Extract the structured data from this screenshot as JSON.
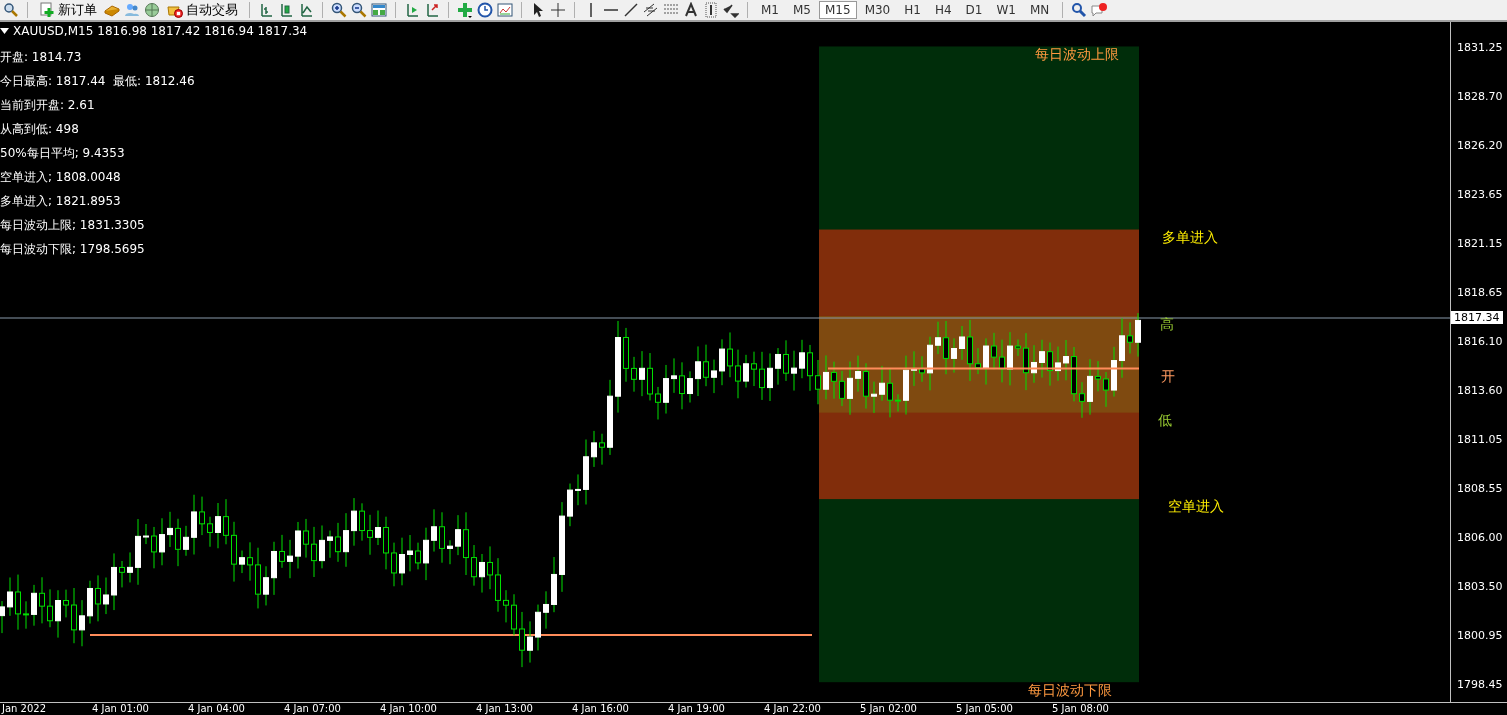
{
  "toolbar": {
    "buttons": [
      {
        "label": "新订单"
      },
      {
        "label": "自动交易"
      }
    ],
    "timeframes": [
      {
        "label": "M1",
        "selected": false
      },
      {
        "label": "M5",
        "selected": false
      },
      {
        "label": "M15",
        "selected": true
      },
      {
        "label": "M30",
        "selected": false
      },
      {
        "label": "H1",
        "selected": false
      },
      {
        "label": "H4",
        "selected": false
      },
      {
        "label": "D1",
        "selected": false
      },
      {
        "label": "W1",
        "selected": false
      },
      {
        "label": "MN",
        "selected": false
      }
    ]
  },
  "chart": {
    "symbol": "XAUUSD,M15",
    "ohlc": "1816.98 1817.42 1816.94 1817.34",
    "info_lines": [
      "开盘: 1814.73",
      "今日最高: 1817.44  最低: 1812.46",
      "当前到开盘: 2.61",
      "从高到低: 498",
      "50%每日平均; 9.4353",
      "空单进入; 1808.0048",
      "多单进入; 1821.8953",
      "每日波动上限; 1831.3305",
      "每日波动下限; 1798.5695"
    ],
    "zone_labels": {
      "upper_limit": "每日波动上限",
      "long_entry": "多单进入",
      "high": "高",
      "open": "开",
      "low": "低",
      "short_entry": "空单进入",
      "lower_limit": "每日波动下限"
    },
    "price_axis": [
      "1831.25",
      "1828.70",
      "1826.20",
      "1823.65",
      "1821.15",
      "1818.65",
      "1816.10",
      "1813.60",
      "1811.05",
      "1808.55",
      "1806.00",
      "1803.50",
      "1800.95",
      "1798.45"
    ],
    "current_price": "1817.34",
    "time_axis": [
      "Jan 2022",
      "4 Jan 01:00",
      "4 Jan 04:00",
      "4 Jan 07:00",
      "4 Jan 10:00",
      "4 Jan 13:00",
      "4 Jan 16:00",
      "4 Jan 19:00",
      "4 Jan 22:00",
      "5 Jan 02:00",
      "5 Jan 05:00",
      "5 Jan 08:00"
    ]
  }
}
